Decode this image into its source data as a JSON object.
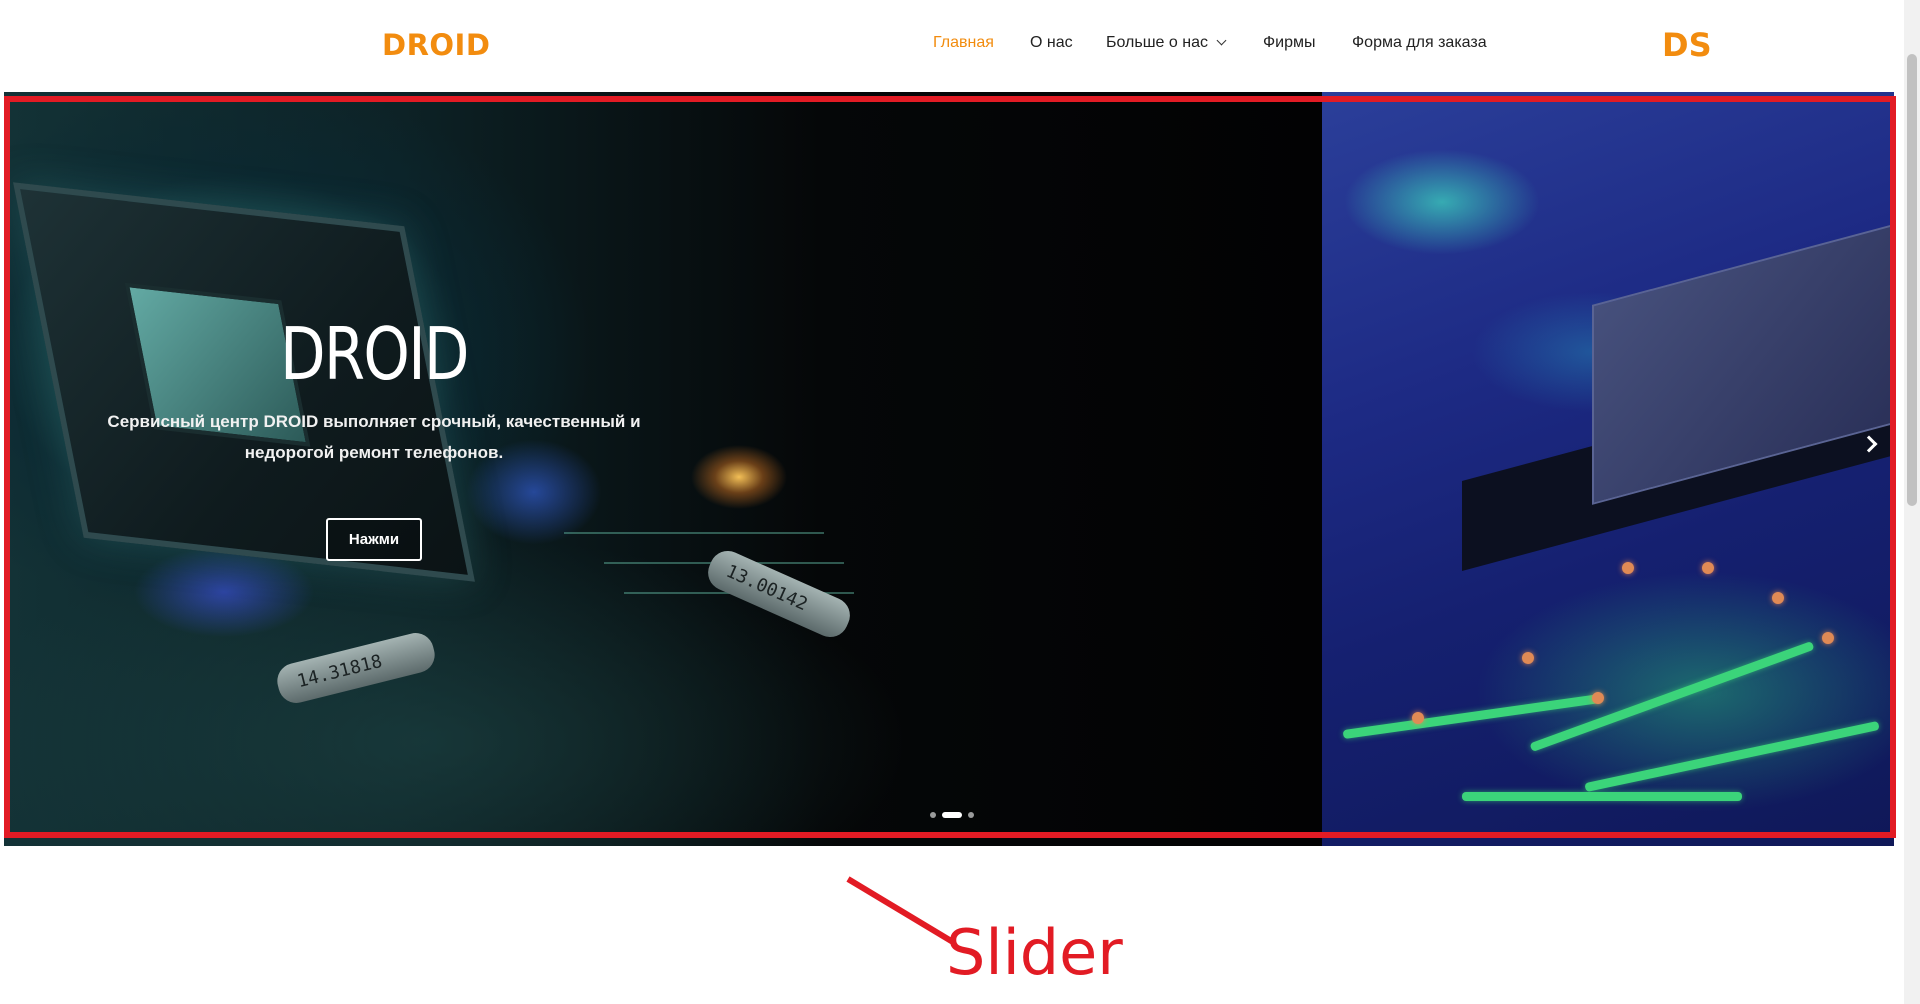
{
  "header": {
    "logo_left": "DROID",
    "logo_right": "DS",
    "nav": [
      {
        "label": "Главная",
        "active": true
      },
      {
        "label": "О нас",
        "active": false
      },
      {
        "label": "Больше о нас",
        "active": false,
        "dropdown": true
      },
      {
        "label": "Фирмы",
        "active": false
      },
      {
        "label": "Форма для заказа",
        "active": false
      }
    ]
  },
  "slider": {
    "slides": [
      {
        "title": "DROID",
        "description": "Сервисный центр DROID выполняет срочный, качественный и недорогой ремонт телефонов.",
        "button_label": "Нажми"
      }
    ],
    "capacitor_labels": [
      "14.31818",
      "13.00142"
    ],
    "dots_count": 3,
    "active_dot": 2,
    "next_icon": "chevron-right-icon"
  },
  "annotation": {
    "label": "Slider",
    "color": "#e21b24"
  },
  "colors": {
    "accent": "#f28c0f"
  }
}
